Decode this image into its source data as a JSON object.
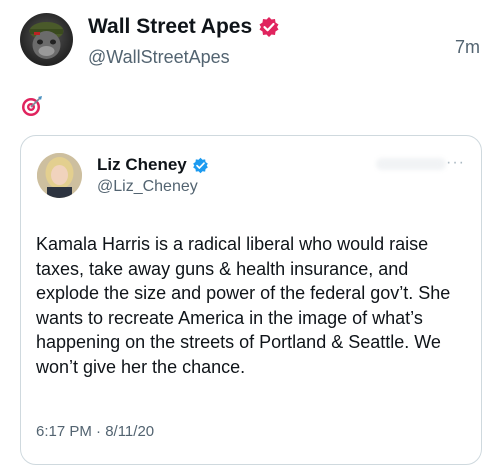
{
  "outer_tweet": {
    "display_name": "Wall Street Apes",
    "handle": "@WallStreetApes",
    "time": "7m",
    "verified_badge_color": "#e0245e",
    "emoji": "target-emoji"
  },
  "quoted_tweet": {
    "display_name": "Liz Cheney",
    "handle": "@Liz_Cheney",
    "verified_badge_color": "#1d9bf0",
    "text": "Kamala Harris is a radical liberal who would raise taxes, take away guns & health insurance, and explode the size and power of the federal gov’t. She wants to recreate America in the image of what’s happening on the streets of Portland & Seattle. We won’t give her the chance.",
    "timestamp": "6:17 PM · 8/11/20",
    "more_label": "···"
  }
}
